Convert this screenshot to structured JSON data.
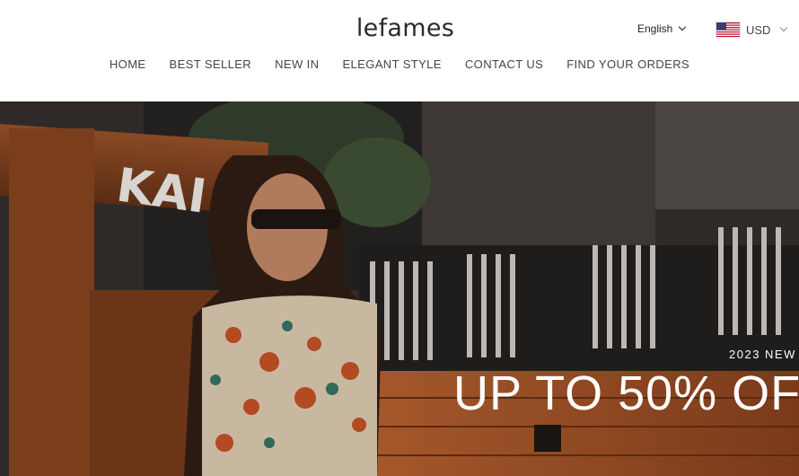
{
  "header": {
    "logo": "lefames",
    "language": "English",
    "currency": "USD"
  },
  "nav": {
    "items": [
      {
        "label": "HOME"
      },
      {
        "label": "BEST SELLER"
      },
      {
        "label": "NEW IN"
      },
      {
        "label": "ELEGANT STYLE"
      },
      {
        "label": "CONTACT US"
      },
      {
        "label": "FIND YOUR ORDERS"
      }
    ]
  },
  "hero": {
    "sign_text": "KAI",
    "kicker": "2023 NEW",
    "headline": "UP TO 50% OF"
  }
}
